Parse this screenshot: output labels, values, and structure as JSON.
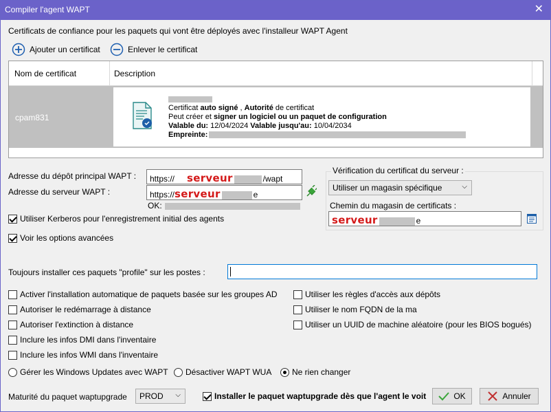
{
  "window": {
    "title": "Compiler l'agent WAPT",
    "close": "✕"
  },
  "certs": {
    "intro": "Certificats de confiance pour les paquets qui vont être déployés avec l'installeur WAPT Agent",
    "add_label": "Ajouter un certificat",
    "remove_label": "Enlever le certificat",
    "columns": [
      "Nom de certificat",
      "Description"
    ],
    "row": {
      "name": "cpam831",
      "line1_pre": "Certificat ",
      "line1_b1": "auto signé",
      "line1_mid": " , ",
      "line1_b2": "Autorité",
      "line1_post": " de certificat",
      "line2_pre": "Peut créer et ",
      "line2_b": "signer un logiciel ou un paquet de configuration",
      "line3_k1": "Valable du:",
      "line3_v1": " 12/04/2024 ",
      "line3_k2": "Valable jusqu'au:",
      "line3_v2": " 10/04/2034",
      "line4_k": "Empreinte:"
    }
  },
  "repo": {
    "label": "Adresse du dépôt principal WAPT :",
    "prefix": "https://",
    "redact": "serveur",
    "suffix": "/wapt"
  },
  "server": {
    "label": "Adresse du serveur WAPT :",
    "prefix": "https://",
    "redact": "serveur",
    "suffix": "e",
    "status": "OK:"
  },
  "verif": {
    "group": "Vérification du certificat du serveur :",
    "select": "Utiliser un magasin spécifique",
    "store_label": "Chemin du magasin de certificats :",
    "store_redact": "serveur",
    "store_suffix": "e"
  },
  "kerberos": "Utiliser Kerberos pour l'enregistrement initial des agents",
  "advanced": "Voir les options avancées",
  "profiles_label": "Toujours installer ces paquets \"profile\" sur les postes :",
  "profiles_value": "",
  "options_left": [
    "Activer l'installation automatique de paquets basée sur les groupes AD",
    "Autoriser le redémarrage à distance",
    "Autoriser l'extinction à distance",
    "Inclure les infos DMI dans l'inventaire",
    "Inclure les infos WMI dans l'inventaire"
  ],
  "options_right": [
    "Utiliser les règles d'accès aux dépôts",
    "Utiliser le nom FQDN de la ma",
    "Utiliser un UUID de machine aléatoire (pour les BIOS bogués)"
  ],
  "wu": {
    "opt1": "Gérer les Windows Updates avec WAPT",
    "opt2": "Désactiver WAPT WUA",
    "opt3": "Ne rien changer"
  },
  "footer": {
    "maturity_label": "Maturité du paquet waptupgrade",
    "maturity_value": "PROD",
    "install_upgrade": "Installer le paquet waptupgrade dès que l'agent le voit",
    "ok": "OK",
    "cancel": "Annuler"
  },
  "colors": {
    "titlebar": "#6b62c9",
    "selected_row": "#c0c0c0",
    "redaction_text": "#d41a1a"
  }
}
